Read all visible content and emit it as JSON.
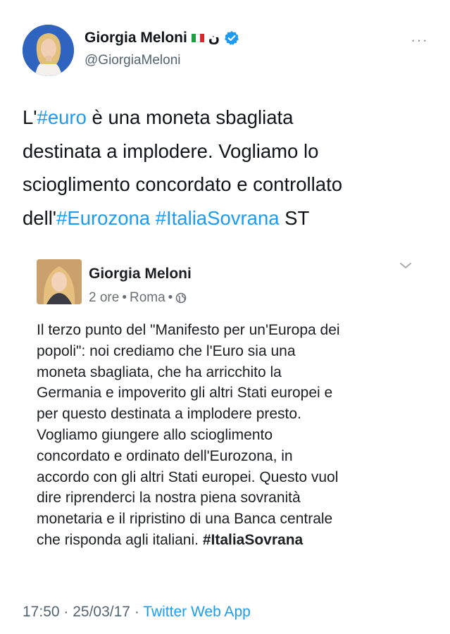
{
  "author": {
    "name": "Giorgia Meloni",
    "flag": "italy-flag-icon",
    "arabic_glyph": "ن",
    "verified": "verified-badge-icon",
    "handle": "@GiorgiaMeloni"
  },
  "more_label": "···",
  "tweet": {
    "lines": [
      [
        {
          "t": "L'",
          "tag": false
        },
        {
          "t": "#euro",
          "tag": true
        },
        {
          "t": " è una moneta sbagliata",
          "tag": false
        }
      ],
      [
        {
          "t": "destinata a implodere. Vogliamo lo",
          "tag": false
        }
      ],
      [
        {
          "t": "scioglimento concordato e controllato",
          "tag": false
        }
      ],
      [
        {
          "t": "dell'",
          "tag": false
        },
        {
          "t": "#Eurozona",
          "tag": true
        },
        {
          "t": " ",
          "tag": false
        },
        {
          "t": "#ItaliaSovrana",
          "tag": true
        },
        {
          "t": " ST",
          "tag": false
        }
      ]
    ]
  },
  "quoted_post": {
    "name": "Giorgia Meloni",
    "time": "2 ore",
    "location": "Roma",
    "privacy_icon": "globe-icon",
    "menu_icon": "chevron-down-icon",
    "body_lines": [
      "Il terzo punto del \"Manifesto per un'Europa dei",
      "popoli\": noi crediamo che l'Euro sia una",
      "moneta sbagliata, che ha arricchito la",
      "Germania e impoverito gli altri Stati europei  e",
      "per questo destinata a implodere presto.",
      "Vogliamo giungere allo scioglimento",
      "concordato e ordinato dell'Eurozona, in",
      "accordo con gli altri Stati europei. Questo vuol",
      "dire riprenderci la nostra piena sovranità",
      "monetaria e il ripristino di una Banca centrale"
    ],
    "last_line_text": "che risponda agli italiani. ",
    "last_line_hashtag": "#ItaliaSovrana"
  },
  "footer": {
    "time": "17:50",
    "date": "25/03/17",
    "source": "Twitter Web App"
  },
  "colors": {
    "link": "#1d9bf0",
    "secondary": "#536471",
    "verified": "#1d9bf0"
  }
}
